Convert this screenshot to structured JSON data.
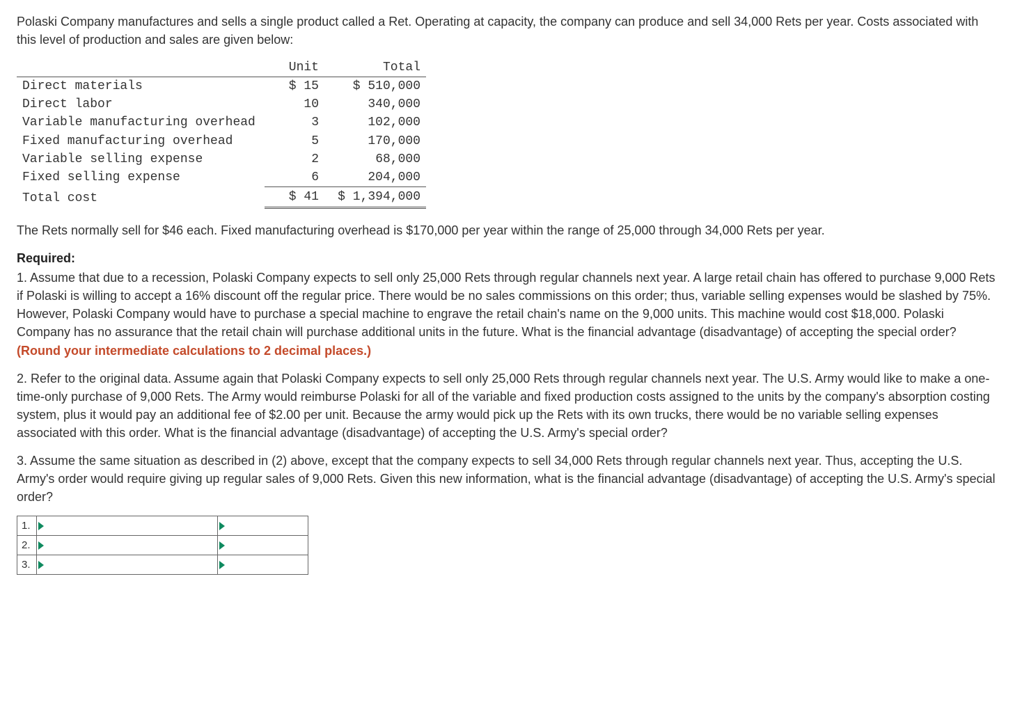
{
  "intro": "Polaski Company manufactures and sells a single product called a Ret. Operating at capacity, the company can produce and sell 34,000 Rets per year. Costs associated with this level of production and sales are given below:",
  "cost_table": {
    "headers": {
      "unit": "Unit",
      "total": "Total"
    },
    "rows": [
      {
        "label": "Direct materials",
        "unit": "$ 15",
        "total": "$ 510,000"
      },
      {
        "label": "Direct labor",
        "unit": "10",
        "total": "340,000"
      },
      {
        "label": "Variable manufacturing overhead",
        "unit": "3",
        "total": "102,000"
      },
      {
        "label": "Fixed manufacturing overhead",
        "unit": "5",
        "total": "170,000"
      },
      {
        "label": "Variable selling expense",
        "unit": "2",
        "total": "68,000"
      },
      {
        "label": "Fixed selling expense",
        "unit": "6",
        "total": "204,000"
      }
    ],
    "total_row": {
      "label": "Total cost",
      "unit": "$ 41",
      "total": "$ 1,394,000"
    }
  },
  "para_after_table": "The Rets normally sell for $46 each. Fixed manufacturing overhead is $170,000 per year within the range of 25,000 through 34,000 Rets per year.",
  "required_label": "Required:",
  "q1_text": "1. Assume that due to a recession, Polaski Company expects to sell only 25,000 Rets through regular channels next year. A large retail chain has offered to purchase 9,000 Rets if Polaski is willing to accept a 16% discount off the regular price. There would be no sales commissions on this order; thus, variable selling expenses would be slashed by 75%. However, Polaski Company would have to purchase a special machine to engrave the retail chain's name on the 9,000 units. This machine would cost $18,000. Polaski Company has no assurance that the retail chain will purchase additional units in the future. What is the financial advantage (disadvantage) of accepting the special order? ",
  "q1_hint": "(Round your intermediate calculations to 2 decimal places.)",
  "q2_text": "2. Refer to the original data. Assume again that Polaski Company expects to sell only 25,000 Rets through regular channels next year. The U.S. Army would like to make a one-time-only purchase of 9,000 Rets. The Army would reimburse Polaski for all of the variable and fixed production costs assigned to the units by the company's absorption costing system, plus it would pay an additional fee of $2.00 per unit. Because the army would pick up the Rets with its own trucks, there would be no variable selling expenses associated with this order. What is the financial advantage (disadvantage) of accepting the U.S. Army's special order?",
  "q3_text": "3. Assume the same situation as described in (2) above, except that the company expects to sell 34,000 Rets through regular channels next year. Thus, accepting the U.S. Army's order would require giving up regular sales of 9,000 Rets. Given this new information, what is the financial advantage (disadvantage) of accepting the U.S. Army's special order?",
  "answer_rows": [
    "1.",
    "2.",
    "3."
  ]
}
